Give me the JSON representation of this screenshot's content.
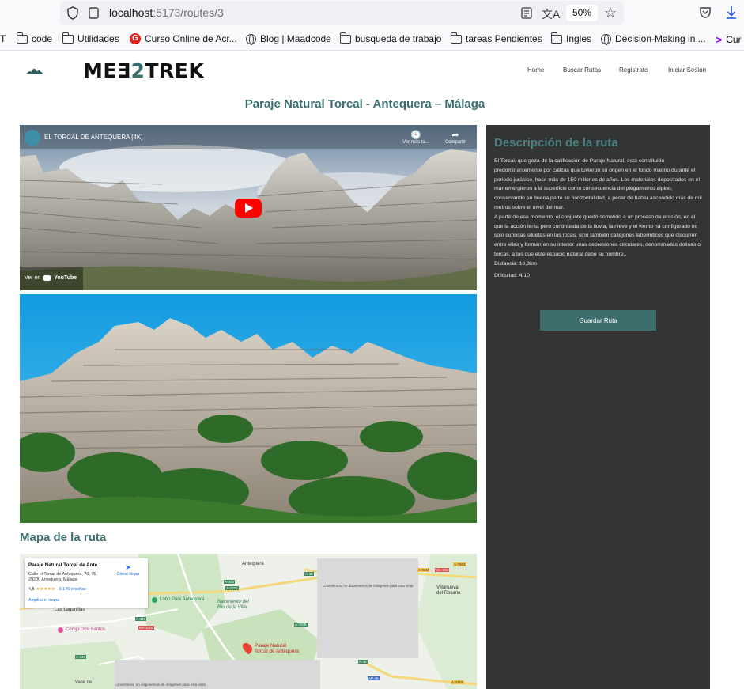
{
  "browser": {
    "url_host": "localhost",
    "url_path": ":5173/routes/3",
    "zoom": "50%"
  },
  "bookmarks": [
    {
      "label": "T",
      "icon": "none"
    },
    {
      "label": "code",
      "icon": "folder-icon"
    },
    {
      "label": "Utilidades",
      "icon": "folder-icon"
    },
    {
      "label": "Curso Online de Acr...",
      "icon": "g-logo-icon"
    },
    {
      "label": "Blog | Maadcode",
      "icon": "globe-icon"
    },
    {
      "label": "busqueda de trabajo",
      "icon": "folder-icon"
    },
    {
      "label": "tareas Pendientes",
      "icon": "folder-icon"
    },
    {
      "label": "Ingles",
      "icon": "folder-icon"
    },
    {
      "label": "Decision-Making in ...",
      "icon": "globe-icon"
    },
    {
      "label": "Cur",
      "icon": "arrow-icon"
    }
  ],
  "site": {
    "logo_pre": "ME",
    "logo_mid_a": "E",
    "logo_two": "2",
    "logo_post": "TREK",
    "nav": [
      "Home",
      "Buscar Rutas",
      "Registrate",
      "Iniciar Sesión"
    ]
  },
  "route": {
    "title": "Paraje Natural Torcal - Antequera – Málaga",
    "video_title": "EL TORCAL DE ANTEQUERA [4K]",
    "video_watch_later": "Ver más ta...",
    "video_share": "Compartir",
    "video_watch_on": "Ver en",
    "video_brand": "YouTube",
    "map_heading": "Mapa de la ruta",
    "description_heading": "Descripción de la ruta",
    "description_p1": "El Torcal, que goza de la calificación de Paraje Natural, está constituido predominantemente por calizas que tuvieron su origen en el fondo marino durante el periodo jurásico, hace más de 150 millones de años. Los materiales depositados en el mar emergieron a la superficie como consecuencia del plegamiento alpino, conservando en buena parte su horizontalidad, a pesar de haber ascendido más de mil metros sobre el nivel del mar.",
    "description_p2": "A partir de ese momento, el conjunto quedó sometido a un proceso de erosión, en el que la acción lenta pero continuada de la lluvia, la nieve y el viento ha configurado no solo curiosas siluetas en las rocas, sino también callejones laberínticos que discurren entre ellas y forman en su interior unas depresiones circulares, denominadas dolinas o torcas, a las que este espacio natural debe su nombre..",
    "distance": "Distancia: 10,3km",
    "difficulty": "Dificultad: 4/10",
    "save_button": "Guardar Ruta"
  },
  "map": {
    "card_title": "Paraje Natural Torcal de Ante...",
    "card_address_1": "Calle el Torcal de Antequera, 70, 75,",
    "card_address_2": "29200 Antequera, Málaga",
    "card_rating": "4,8",
    "card_stars": "★★★★★",
    "card_reviews": "9.146 reseñas",
    "card_directions": "Cómo llegar",
    "card_larger_map": "Ampliar el mapa",
    "labels": {
      "antequera": "Antequera",
      "lobo_park": "Lobo Park Antequera",
      "nacimiento_1": "Nacimiento del",
      "nacimiento_2": "Río de la Villa",
      "lagunillas": "Las Lagunillas",
      "cortijo": "Cortijo Dos Santos",
      "pin_1": "Paraje Natural",
      "pin_2": "Torcal de Antequera",
      "villanueva_1": "Villanueva",
      "villanueva_2": "del Rosario",
      "valle": "Valle de",
      "no_images": "Lo sentimos, no disponemos de imágenes para esta vista",
      "road_a45": "A-45",
      "road_a343": "A-343",
      "road_a7075": "A-7075",
      "road_a7281": "A-7281",
      "road_ma4402": "MA-4402",
      "road_ma224": "MA-224",
      "road_a7203": "A-7203",
      "road_a92m": "A-92M",
      "road_a343b": "A-343",
      "road_a7075b": "A-7075",
      "road_a343c": "A-343",
      "road_ap46": "AP-46",
      "road_a4152": "A-4152"
    }
  }
}
